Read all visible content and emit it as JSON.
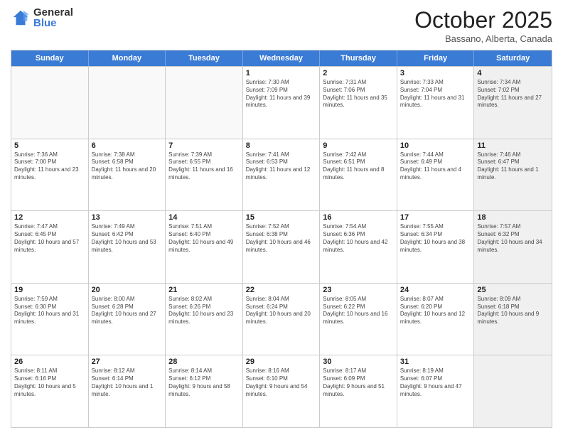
{
  "logo": {
    "general": "General",
    "blue": "Blue"
  },
  "header": {
    "month": "October 2025",
    "location": "Bassano, Alberta, Canada"
  },
  "days_of_week": [
    "Sunday",
    "Monday",
    "Tuesday",
    "Wednesday",
    "Thursday",
    "Friday",
    "Saturday"
  ],
  "weeks": [
    [
      {
        "day": "",
        "empty": true
      },
      {
        "day": "",
        "empty": true
      },
      {
        "day": "",
        "empty": true
      },
      {
        "day": "1",
        "sunrise": "7:30 AM",
        "sunset": "7:09 PM",
        "daylight": "11 hours and 39 minutes."
      },
      {
        "day": "2",
        "sunrise": "7:31 AM",
        "sunset": "7:06 PM",
        "daylight": "11 hours and 35 minutes."
      },
      {
        "day": "3",
        "sunrise": "7:33 AM",
        "sunset": "7:04 PM",
        "daylight": "11 hours and 31 minutes."
      },
      {
        "day": "4",
        "sunrise": "7:34 AM",
        "sunset": "7:02 PM",
        "daylight": "11 hours and 27 minutes.",
        "shaded": true
      }
    ],
    [
      {
        "day": "5",
        "sunrise": "7:36 AM",
        "sunset": "7:00 PM",
        "daylight": "11 hours and 23 minutes."
      },
      {
        "day": "6",
        "sunrise": "7:38 AM",
        "sunset": "6:58 PM",
        "daylight": "11 hours and 20 minutes."
      },
      {
        "day": "7",
        "sunrise": "7:39 AM",
        "sunset": "6:55 PM",
        "daylight": "11 hours and 16 minutes."
      },
      {
        "day": "8",
        "sunrise": "7:41 AM",
        "sunset": "6:53 PM",
        "daylight": "11 hours and 12 minutes."
      },
      {
        "day": "9",
        "sunrise": "7:42 AM",
        "sunset": "6:51 PM",
        "daylight": "11 hours and 8 minutes."
      },
      {
        "day": "10",
        "sunrise": "7:44 AM",
        "sunset": "6:49 PM",
        "daylight": "11 hours and 4 minutes."
      },
      {
        "day": "11",
        "sunrise": "7:46 AM",
        "sunset": "6:47 PM",
        "daylight": "11 hours and 1 minute.",
        "shaded": true
      }
    ],
    [
      {
        "day": "12",
        "sunrise": "7:47 AM",
        "sunset": "6:45 PM",
        "daylight": "10 hours and 57 minutes."
      },
      {
        "day": "13",
        "sunrise": "7:49 AM",
        "sunset": "6:42 PM",
        "daylight": "10 hours and 53 minutes."
      },
      {
        "day": "14",
        "sunrise": "7:51 AM",
        "sunset": "6:40 PM",
        "daylight": "10 hours and 49 minutes."
      },
      {
        "day": "15",
        "sunrise": "7:52 AM",
        "sunset": "6:38 PM",
        "daylight": "10 hours and 46 minutes."
      },
      {
        "day": "16",
        "sunrise": "7:54 AM",
        "sunset": "6:36 PM",
        "daylight": "10 hours and 42 minutes."
      },
      {
        "day": "17",
        "sunrise": "7:55 AM",
        "sunset": "6:34 PM",
        "daylight": "10 hours and 38 minutes."
      },
      {
        "day": "18",
        "sunrise": "7:57 AM",
        "sunset": "6:32 PM",
        "daylight": "10 hours and 34 minutes.",
        "shaded": true
      }
    ],
    [
      {
        "day": "19",
        "sunrise": "7:59 AM",
        "sunset": "6:30 PM",
        "daylight": "10 hours and 31 minutes."
      },
      {
        "day": "20",
        "sunrise": "8:00 AM",
        "sunset": "6:28 PM",
        "daylight": "10 hours and 27 minutes."
      },
      {
        "day": "21",
        "sunrise": "8:02 AM",
        "sunset": "6:26 PM",
        "daylight": "10 hours and 23 minutes."
      },
      {
        "day": "22",
        "sunrise": "8:04 AM",
        "sunset": "6:24 PM",
        "daylight": "10 hours and 20 minutes."
      },
      {
        "day": "23",
        "sunrise": "8:05 AM",
        "sunset": "6:22 PM",
        "daylight": "10 hours and 16 minutes."
      },
      {
        "day": "24",
        "sunrise": "8:07 AM",
        "sunset": "6:20 PM",
        "daylight": "10 hours and 12 minutes."
      },
      {
        "day": "25",
        "sunrise": "8:09 AM",
        "sunset": "6:18 PM",
        "daylight": "10 hours and 9 minutes.",
        "shaded": true
      }
    ],
    [
      {
        "day": "26",
        "sunrise": "8:11 AM",
        "sunset": "6:16 PM",
        "daylight": "10 hours and 5 minutes."
      },
      {
        "day": "27",
        "sunrise": "8:12 AM",
        "sunset": "6:14 PM",
        "daylight": "10 hours and 1 minute."
      },
      {
        "day": "28",
        "sunrise": "8:14 AM",
        "sunset": "6:12 PM",
        "daylight": "9 hours and 58 minutes."
      },
      {
        "day": "29",
        "sunrise": "8:16 AM",
        "sunset": "6:10 PM",
        "daylight": "9 hours and 54 minutes."
      },
      {
        "day": "30",
        "sunrise": "8:17 AM",
        "sunset": "6:09 PM",
        "daylight": "9 hours and 51 minutes."
      },
      {
        "day": "31",
        "sunrise": "8:19 AM",
        "sunset": "6:07 PM",
        "daylight": "9 hours and 47 minutes."
      },
      {
        "day": "",
        "empty": true,
        "shaded": true
      }
    ]
  ]
}
